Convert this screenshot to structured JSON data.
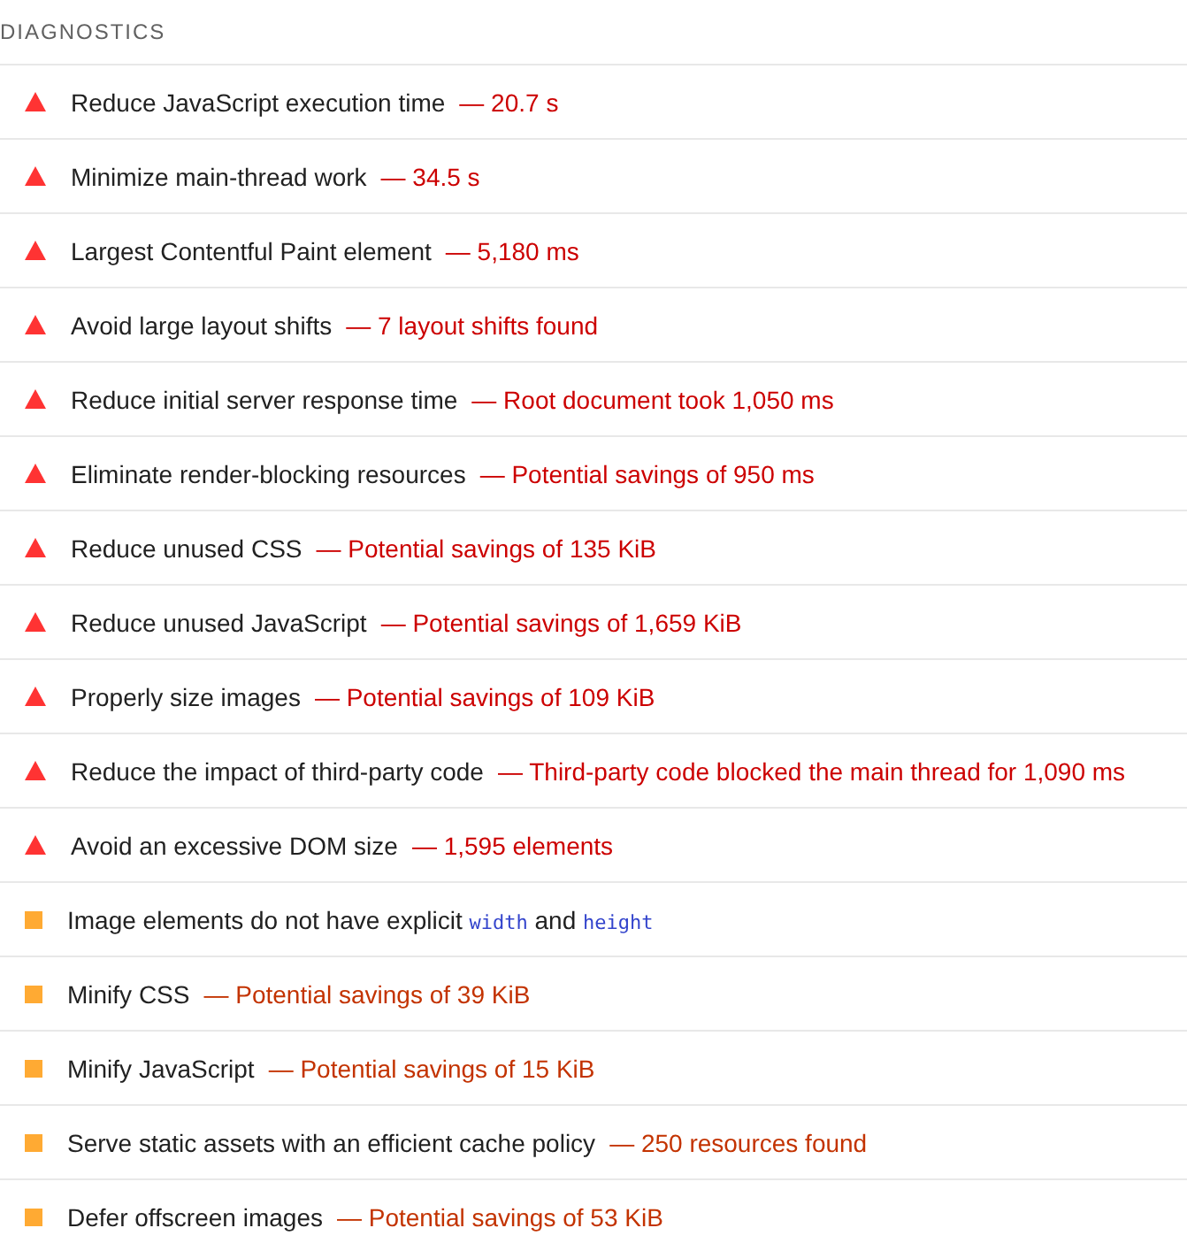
{
  "section": {
    "title": "DIAGNOSTICS"
  },
  "audits": [
    {
      "kind": "fail",
      "title": [
        {
          "kind": "text",
          "text": "Reduce JavaScript execution time"
        }
      ],
      "display": "— 20.7 s"
    },
    {
      "kind": "fail",
      "title": [
        {
          "kind": "text",
          "text": "Minimize main-thread work"
        }
      ],
      "display": "— 34.5 s"
    },
    {
      "kind": "fail",
      "title": [
        {
          "kind": "text",
          "text": "Largest Contentful Paint element"
        }
      ],
      "display": "— 5,180 ms"
    },
    {
      "kind": "fail",
      "title": [
        {
          "kind": "text",
          "text": "Avoid large layout shifts"
        }
      ],
      "display": "— 7 layout shifts found"
    },
    {
      "kind": "fail",
      "title": [
        {
          "kind": "text",
          "text": "Reduce initial server response time"
        }
      ],
      "display": "— Root document took 1,050 ms"
    },
    {
      "kind": "fail",
      "title": [
        {
          "kind": "text",
          "text": "Eliminate render-blocking resources"
        }
      ],
      "display": "— Potential savings of 950 ms"
    },
    {
      "kind": "fail",
      "title": [
        {
          "kind": "text",
          "text": "Reduce unused CSS"
        }
      ],
      "display": "— Potential savings of 135 KiB"
    },
    {
      "kind": "fail",
      "title": [
        {
          "kind": "text",
          "text": "Reduce unused JavaScript"
        }
      ],
      "display": "— Potential savings of 1,659 KiB"
    },
    {
      "kind": "fail",
      "title": [
        {
          "kind": "text",
          "text": "Properly size images"
        }
      ],
      "display": "— Potential savings of 109 KiB"
    },
    {
      "kind": "fail",
      "title": [
        {
          "kind": "text",
          "text": "Reduce the impact of third-party code"
        }
      ],
      "display": "— Third-party code blocked the main thread for 1,090 ms"
    },
    {
      "kind": "fail",
      "title": [
        {
          "kind": "text",
          "text": "Avoid an excessive DOM size"
        }
      ],
      "display": "— 1,595 elements"
    },
    {
      "kind": "average",
      "title": [
        {
          "kind": "text",
          "text": "Image elements do not have explicit"
        },
        {
          "kind": "code",
          "text": "width"
        },
        {
          "kind": "text",
          "text": "and"
        },
        {
          "kind": "code",
          "text": "height"
        }
      ]
    },
    {
      "kind": "average",
      "title": [
        {
          "kind": "text",
          "text": "Minify CSS"
        }
      ],
      "display": "— Potential savings of 39 KiB"
    },
    {
      "kind": "average",
      "title": [
        {
          "kind": "text",
          "text": "Minify JavaScript"
        }
      ],
      "display": "— Potential savings of 15 KiB"
    },
    {
      "kind": "average",
      "title": [
        {
          "kind": "text",
          "text": "Serve static assets with an efficient cache policy"
        }
      ],
      "display": "— 250 resources found"
    },
    {
      "kind": "average",
      "title": [
        {
          "kind": "text",
          "text": "Defer offscreen images"
        }
      ],
      "display": "— Potential savings of 53 KiB"
    }
  ]
}
